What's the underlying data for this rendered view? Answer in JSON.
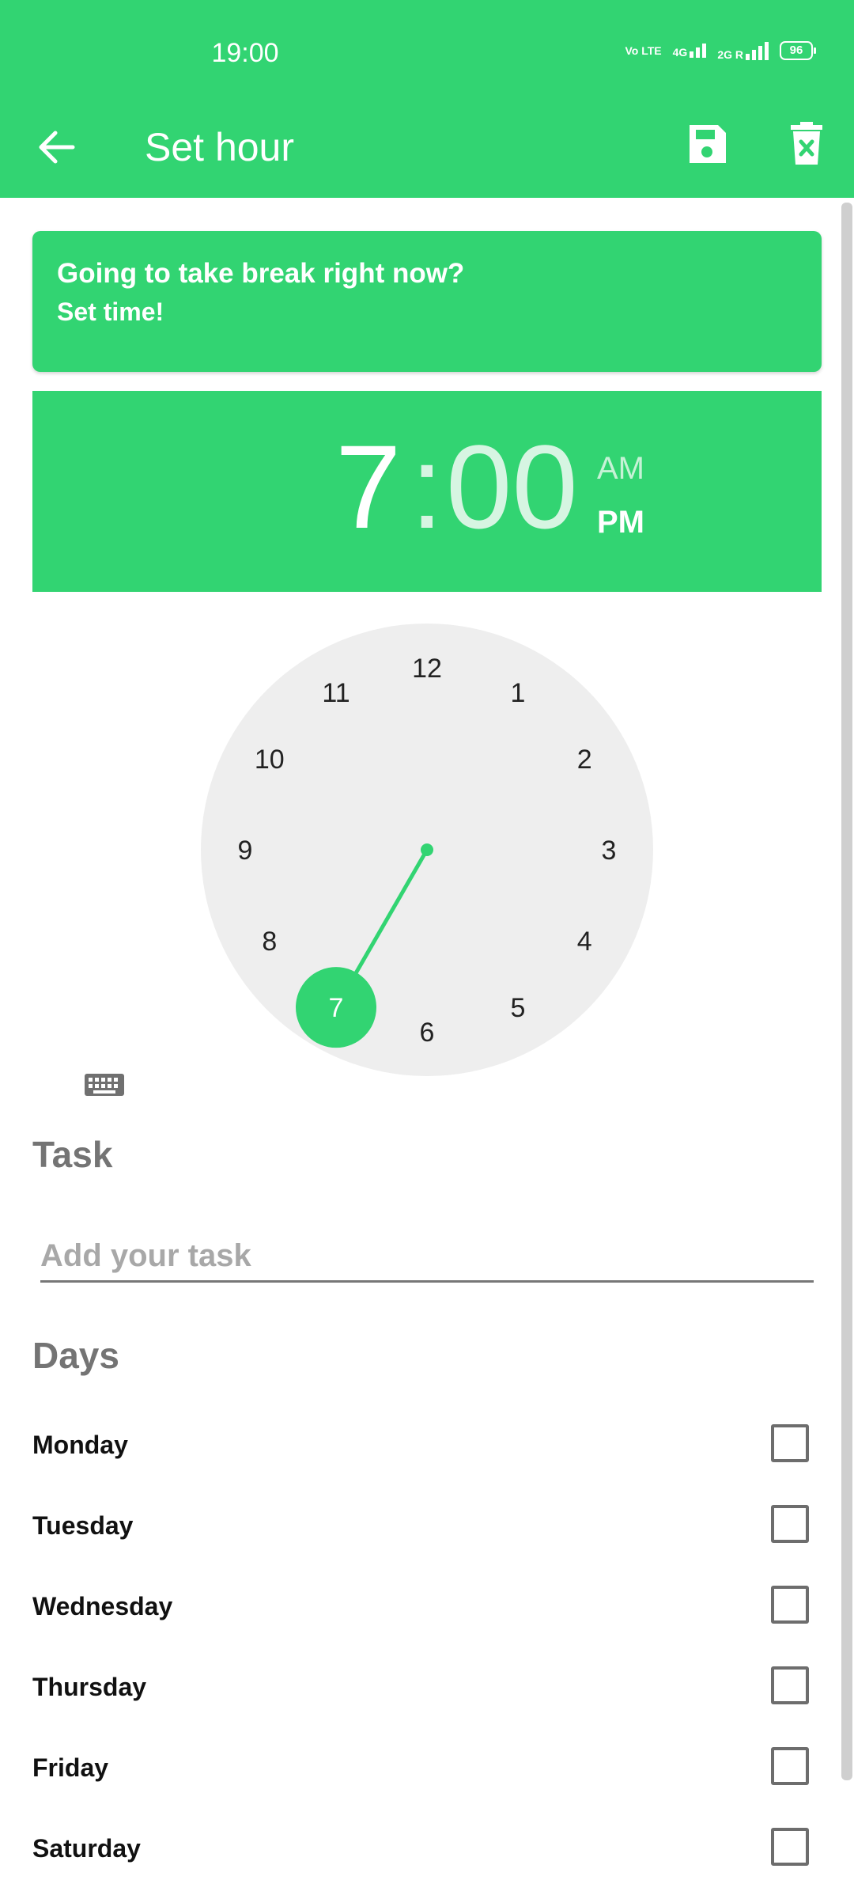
{
  "status_bar": {
    "time": "19:00",
    "network_1": "Vo LTE",
    "network_2": "4G",
    "network_3": "2G R",
    "battery": "96"
  },
  "app_bar": {
    "title": "Set hour",
    "back_icon": "arrow-left-icon",
    "save_icon": "floppy-disk-icon",
    "delete_icon": "delete-icon"
  },
  "banner": {
    "line1": "Going to take break right now?",
    "line2": "Set time!"
  },
  "time_picker": {
    "hour": "7",
    "colon": ":",
    "minute": "00",
    "am": "AM",
    "pm": "PM",
    "selected_period": "PM",
    "selected_hour": 7,
    "clock_numbers": [
      "12",
      "1",
      "2",
      "3",
      "4",
      "5",
      "6",
      "7",
      "8",
      "9",
      "10",
      "11"
    ]
  },
  "task": {
    "heading": "Task",
    "placeholder": "Add your task",
    "value": ""
  },
  "days": {
    "heading": "Days",
    "items": [
      {
        "label": "Monday",
        "checked": false
      },
      {
        "label": "Tuesday",
        "checked": false
      },
      {
        "label": "Wednesday",
        "checked": false
      },
      {
        "label": "Thursday",
        "checked": false
      },
      {
        "label": "Friday",
        "checked": false
      },
      {
        "label": "Saturday",
        "checked": false
      }
    ]
  },
  "colors": {
    "accent": "#32d472",
    "clock_face": "#eeeeee",
    "heading_gray": "#747474"
  }
}
